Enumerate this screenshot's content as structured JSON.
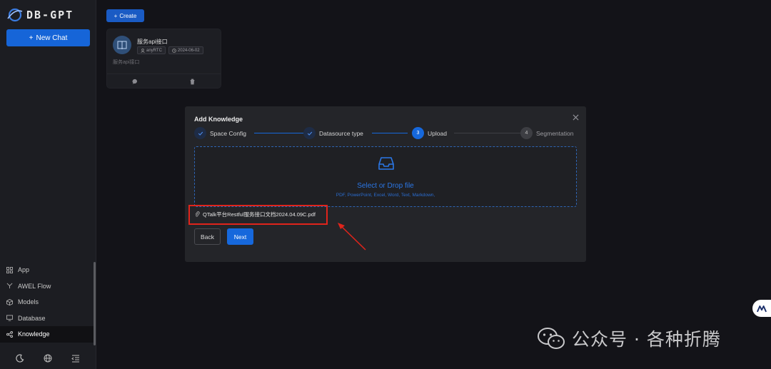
{
  "sidebar": {
    "logo_text": "DB-GPT",
    "new_chat_label": "New Chat",
    "nav_items": [
      {
        "label": "App",
        "icon": "app-grid-icon"
      },
      {
        "label": "AWEL Flow",
        "icon": "flow-icon"
      },
      {
        "label": "Models",
        "icon": "models-cube-icon"
      },
      {
        "label": "Database",
        "icon": "database-icon"
      },
      {
        "label": "Knowledge",
        "icon": "knowledge-share-icon",
        "active": true
      }
    ],
    "bottom_icons": [
      "moon-icon",
      "globe-icon",
      "collapse-menu-icon"
    ]
  },
  "main": {
    "create_label": "Create",
    "card": {
      "title": "服务api接口",
      "owner": "anyRTC",
      "date": "2024-06-02",
      "description": "服务api接口",
      "icons": [
        "chat-bubble-icon",
        "trash-icon"
      ]
    }
  },
  "modal": {
    "title": "Add Knowledge",
    "steps": [
      {
        "number": "1",
        "label": "Space Config",
        "status": "done"
      },
      {
        "number": "2",
        "label": "Datasource type",
        "status": "done"
      },
      {
        "number": "3",
        "label": "Upload",
        "status": "active"
      },
      {
        "number": "4",
        "label": "Segmentation",
        "status": "wait"
      }
    ],
    "dropzone": {
      "title": "Select or Drop file",
      "hint": "PDF, PowerPoint, Excel, Word, Text, Markdown,"
    },
    "file_name": "QTalk平台Restful服务接口文档2024.04.09C.pdf",
    "back_label": "Back",
    "next_label": "Next"
  },
  "watermark": {
    "text": "公众号 · 各种折腾"
  },
  "colors": {
    "primary": "#1668dc",
    "highlight": "#e0241b",
    "background": "#131318",
    "sidebar": "#1c1d22"
  }
}
